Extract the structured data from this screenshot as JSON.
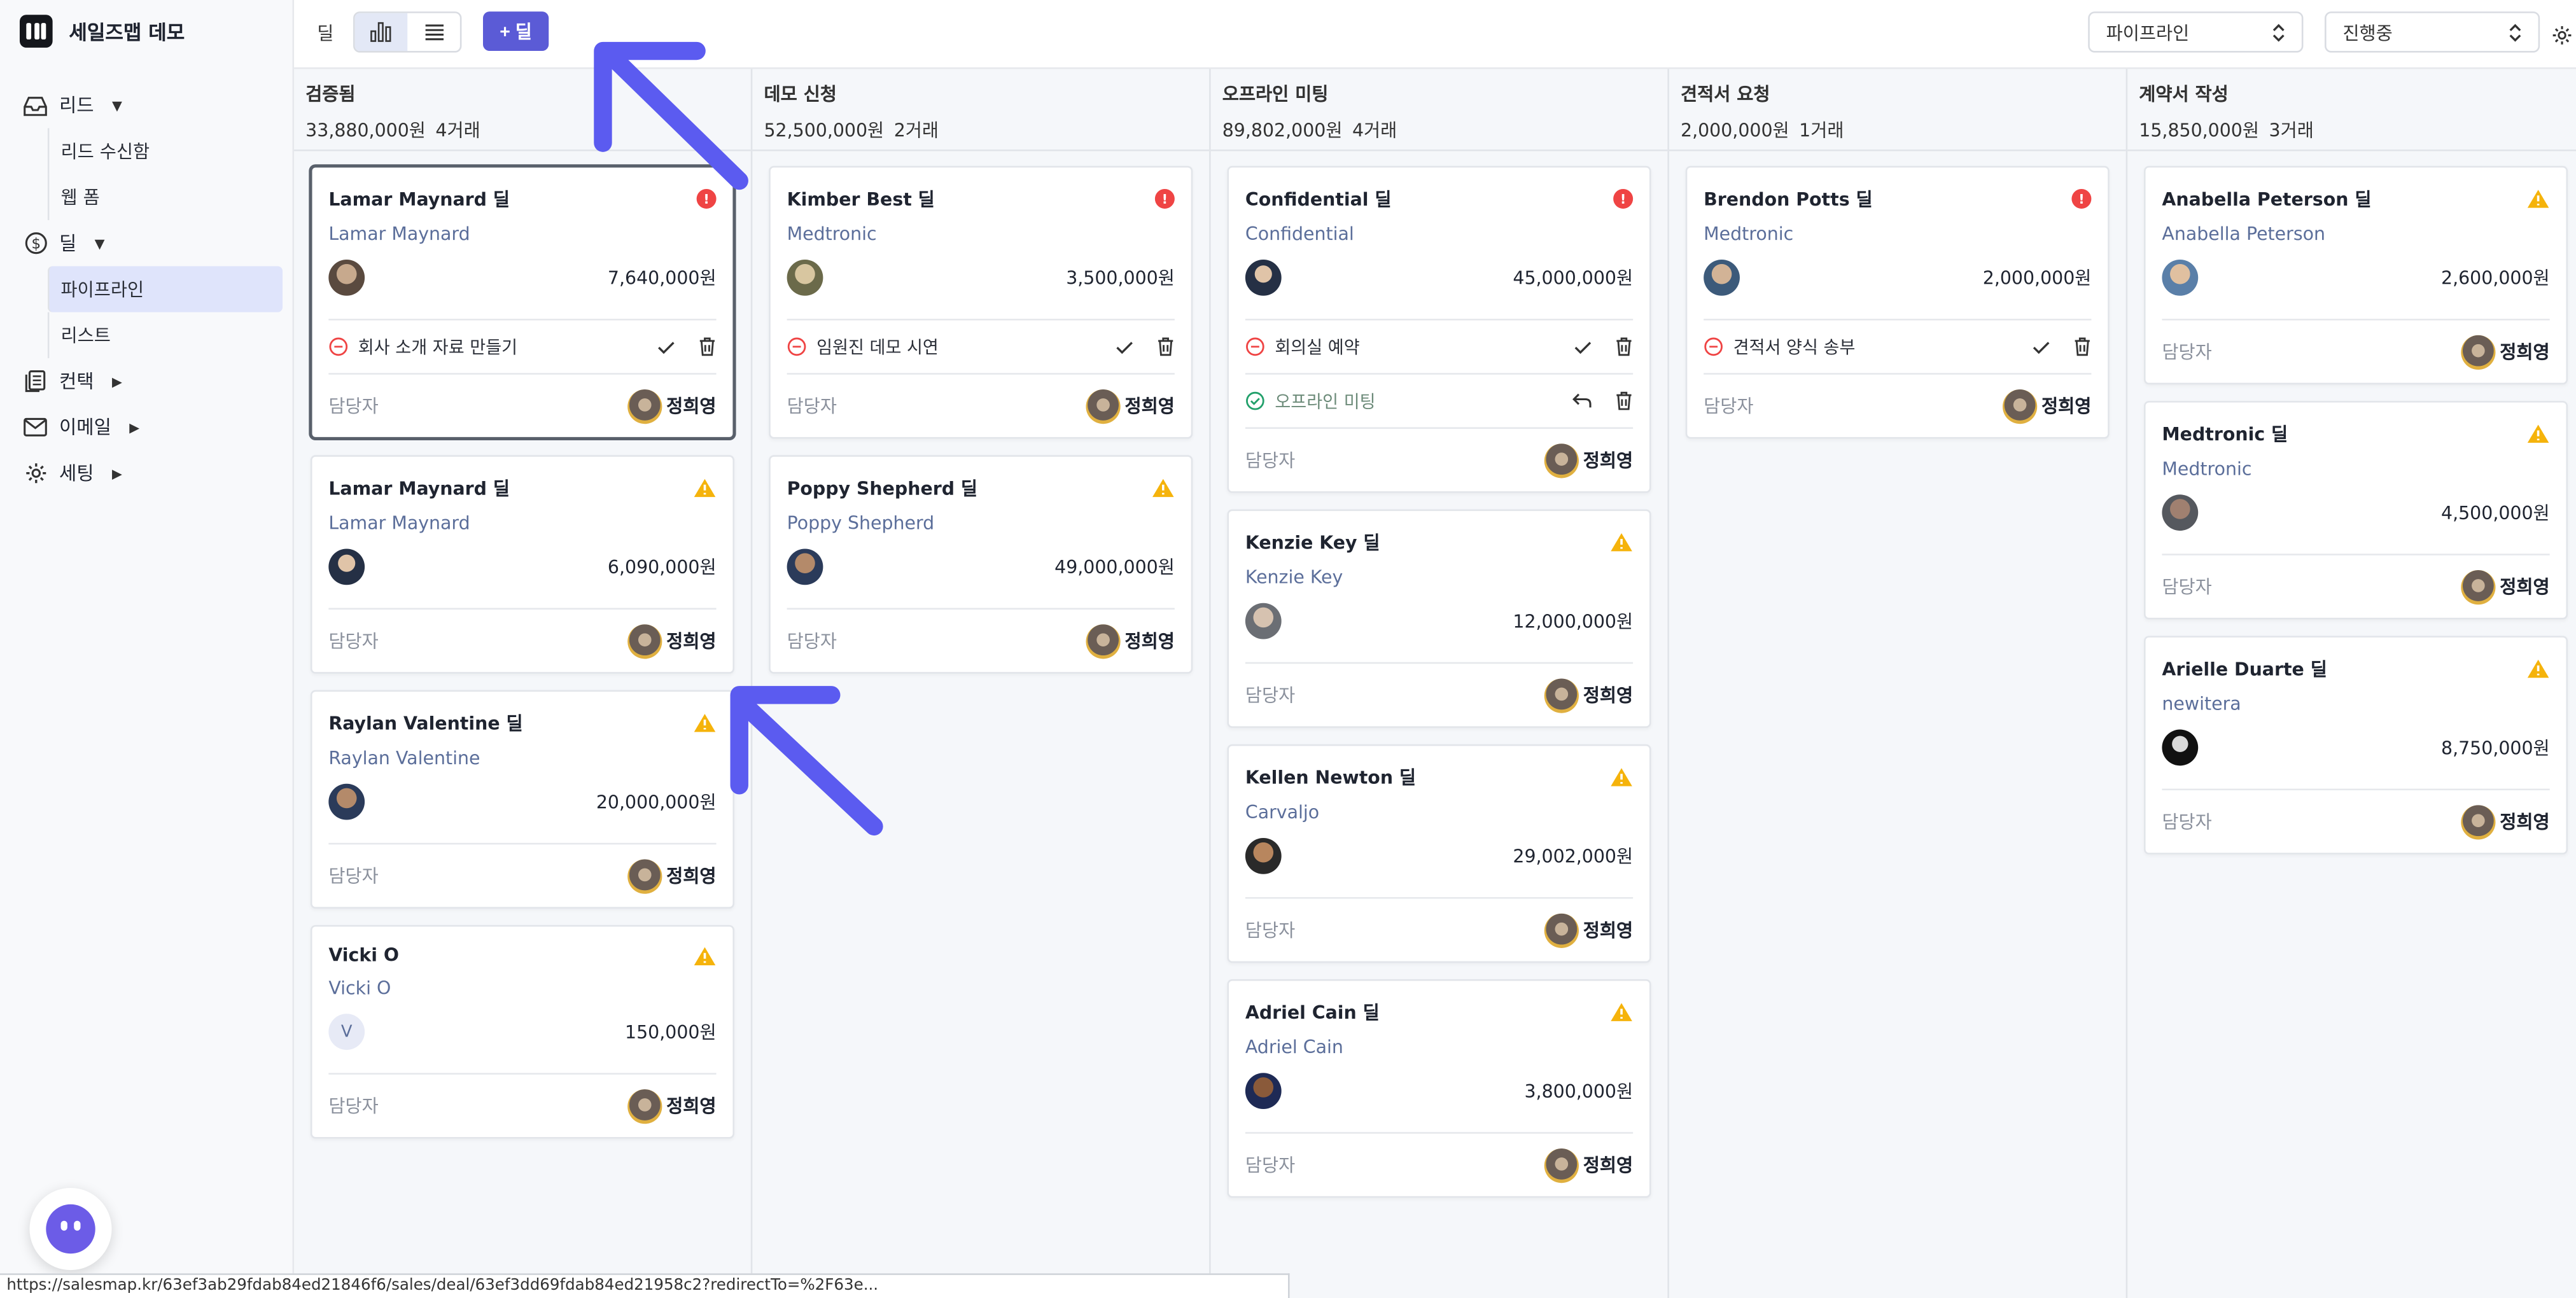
{
  "app": {
    "title": "세일즈맵 데모"
  },
  "sidebar": {
    "lead": {
      "label": "리드",
      "children": [
        "리드 수신함",
        "웹 폼"
      ]
    },
    "deal": {
      "label": "딜",
      "children": [
        "파이프라인",
        "리스트"
      ]
    },
    "contact": {
      "label": "컨택"
    },
    "email": {
      "label": "이메일"
    },
    "settings": {
      "label": "세팅"
    }
  },
  "toolbar": {
    "title": "딜",
    "add_label": "+ 딜",
    "pipeline_select": "파이프라인",
    "status_select": "진행중"
  },
  "columns": [
    {
      "title": "검증됨",
      "amount": "33,880,000원",
      "count": "4거래"
    },
    {
      "title": "데모 신청",
      "amount": "52,500,000원",
      "count": "2거래"
    },
    {
      "title": "오프라인 미팅",
      "amount": "89,802,000원",
      "count": "4거래"
    },
    {
      "title": "견적서 요청",
      "amount": "2,000,000원",
      "count": "1거래"
    },
    {
      "title": "계약서 작성",
      "amount": "15,850,000원",
      "count": "3거래"
    }
  ],
  "cards": {
    "c0_0": {
      "title": "Lamar Maynard 딜",
      "org": "Lamar Maynard",
      "amount": "7,640,000원",
      "task": "회사 소개 자료 만들기"
    },
    "c0_1": {
      "title": "Lamar Maynard 딜",
      "org": "Lamar Maynard",
      "amount": "6,090,000원"
    },
    "c0_2": {
      "title": "Raylan Valentine 딜",
      "org": "Raylan Valentine",
      "amount": "20,000,000원"
    },
    "c0_3": {
      "title": "Vicki O",
      "org": "Vicki O",
      "amount": "150,000원",
      "initial": "V"
    },
    "c1_0": {
      "title": "Kimber Best 딜",
      "org": "Medtronic",
      "amount": "3,500,000원",
      "task": "임원진 데모 시연"
    },
    "c1_1": {
      "title": "Poppy Shepherd 딜",
      "org": "Poppy Shepherd",
      "amount": "49,000,000원"
    },
    "c2_0": {
      "title": "Confidential 딜",
      "org": "Confidential",
      "amount": "45,000,000원",
      "task": "회의실 예약",
      "task2": "오프라인 미팅"
    },
    "c2_1": {
      "title": "Kenzie Key 딜",
      "org": "Kenzie Key",
      "amount": "12,000,000원"
    },
    "c2_2": {
      "title": "Kellen Newton 딜",
      "org": "Carvaljo",
      "amount": "29,002,000원"
    },
    "c2_3": {
      "title": "Adriel Cain 딜",
      "org": "Adriel Cain",
      "amount": "3,800,000원"
    },
    "c3_0": {
      "title": "Brendon Potts 딜",
      "org": "Medtronic",
      "amount": "2,000,000원",
      "task": "견적서 양식 송부"
    },
    "c4_0": {
      "title": "Anabella Peterson 딜",
      "org": "Anabella Peterson",
      "amount": "2,600,000원"
    },
    "c4_1": {
      "title": "Medtronic 딜",
      "org": "Medtronic",
      "amount": "4,500,000원"
    },
    "c4_2": {
      "title": "Arielle Duarte 딜",
      "org": "newitera",
      "amount": "8,750,000원"
    }
  },
  "owner": {
    "label": "담당자",
    "name": "정희영"
  },
  "status_url": "https://salesmap.kr/63ef3ab29fdab84ed21846f6/sales/deal/63ef3dd69fdab84ed21958c2?redirectTo=%2F63e...",
  "colors": {
    "accent": "#5b5bd6",
    "alert_red": "#ef4444",
    "warning": "#f5b30b",
    "org_text": "#5b6e9a"
  }
}
